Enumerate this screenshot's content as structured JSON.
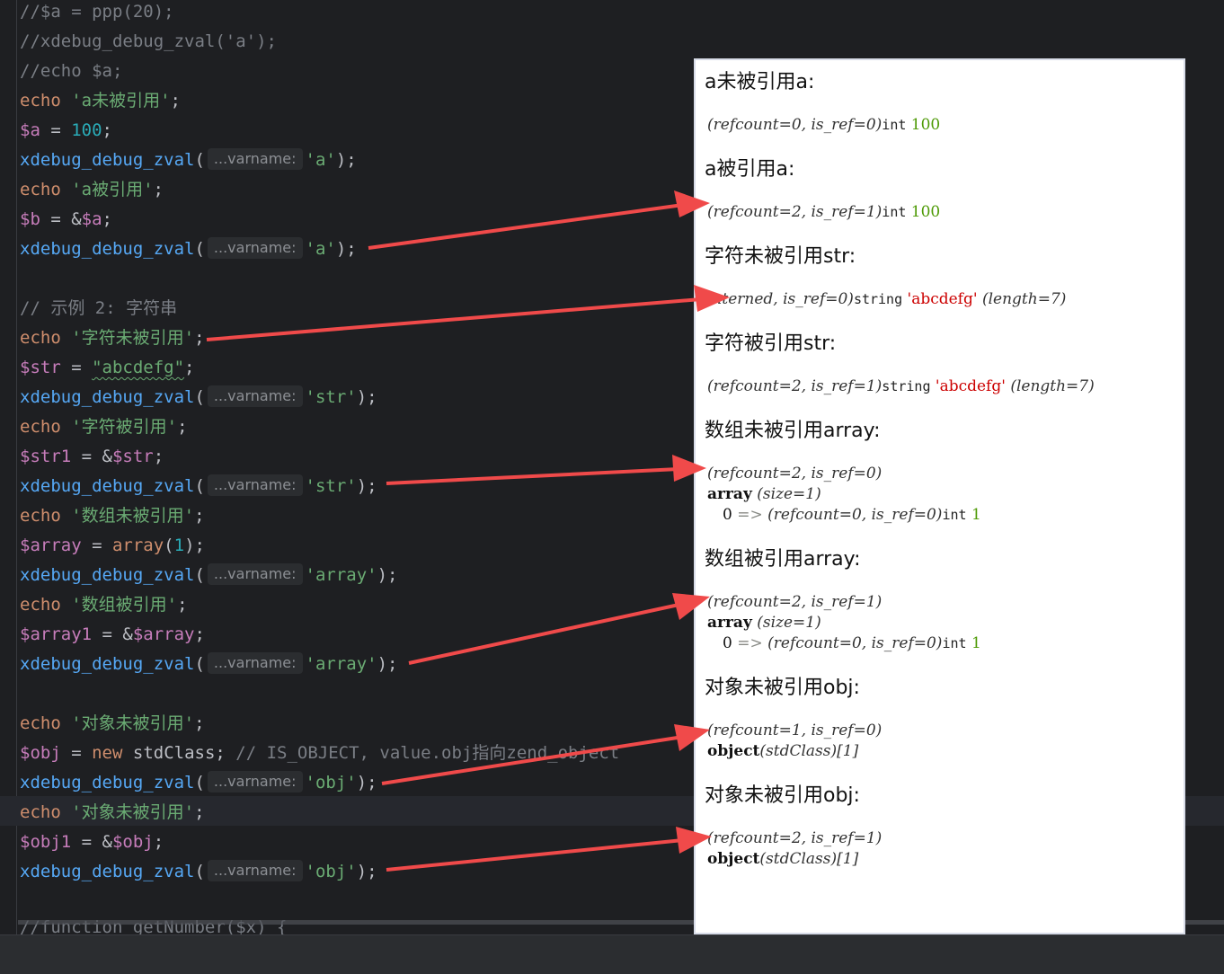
{
  "code": {
    "line1": "//$a = ppp(20);",
    "line2": "//xdebug_debug_zval('a');",
    "line3": "//echo $a;",
    "echo": "echo",
    "xdebug_fn": "xdebug_debug_zval",
    "varname_hint": "...varname:",
    "a_var": "$a",
    "b_var": "$b",
    "str_var": "$str",
    "str1_var": "$str1",
    "array_var": "$array",
    "array1_var": "$array1",
    "obj_var": "$obj",
    "obj1_var": "$obj1",
    "num_100": "100",
    "num_1": "1",
    "str_a_unref": "'a未被引用'",
    "str_a_ref": "'a被引用'",
    "arg_a": "'a'",
    "comment_example2": "// 示例 2: 字符串",
    "str_str_unref": "'字符未被引用'",
    "str_value": "\"abcdefg\"",
    "arg_str": "'str'",
    "str_str_ref": "'字符被引用'",
    "str_arr_unref": "'数组未被引用'",
    "array_fn": "array",
    "arg_array": "'array'",
    "str_arr_ref": "'数组被引用'",
    "str_obj_unref": "'对象未被引用'",
    "new_kw": "new",
    "stdclass": "stdClass",
    "comment_obj": "// IS_OBJECT, value.obj指向zend_object",
    "arg_obj": "'obj'",
    "bottom_cut": "//function getNumber($x) {"
  },
  "output": {
    "h1": "a未被引用a:",
    "l1_meta": "(refcount=0, is_ref=0)",
    "type_int": "int",
    "val_100": "100",
    "h2": "a被引用a:",
    "l2_meta": "(refcount=2, is_ref=1)",
    "h3": "字符未被引用str:",
    "l3_meta": "interned, is_ref=0)",
    "type_string": "string",
    "val_abcdefg": "'abcdefg'",
    "length7": "(length=7)",
    "h4": "字符被引用str:",
    "l4_meta": "(refcount=2, is_ref=1)",
    "h5": "数组未被引用array:",
    "l5_meta": "(refcount=2, is_ref=0)",
    "array_label": "array",
    "size1": "(size=1)",
    "idx0": "0",
    "arrow_sym": "=>",
    "elem_meta": "(refcount=0, is_ref=0)",
    "val_1": "1",
    "h6": "数组被引用array:",
    "l6_meta": "(refcount=2, is_ref=1)",
    "h7": "对象未被引用obj:",
    "l7_meta": "(refcount=1, is_ref=0)",
    "object_label": "object",
    "stdclass_it": "(stdClass)",
    "obj_id": "[1]",
    "h8": "对象未被引用obj:",
    "l8_meta": "(refcount=2, is_ref=1)"
  },
  "colors": {
    "arrow": "#f04a4a",
    "editor_bg": "#1e1f22",
    "keyword": "#cf8e6d",
    "variable": "#c77dbb",
    "function": "#56a8f5",
    "string": "#6aab73",
    "number": "#2aacb8"
  }
}
